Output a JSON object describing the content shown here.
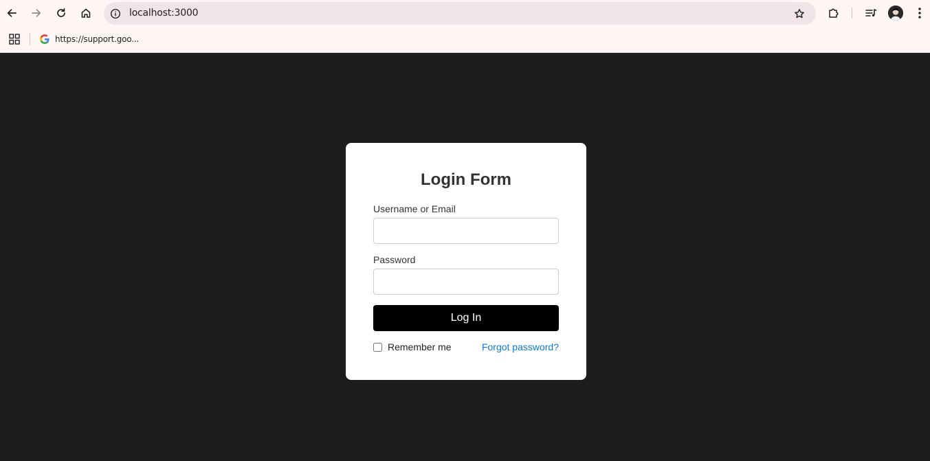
{
  "browser": {
    "url": "localhost:3000",
    "bookmark_label": "https://support.goo..."
  },
  "login": {
    "title": "Login Form",
    "username_label": "Username or Email",
    "username_value": "",
    "password_label": "Password",
    "password_value": "",
    "submit_label": "Log In",
    "remember_label": "Remember me",
    "remember_checked": false,
    "forgot_label": "Forgot password?"
  },
  "colors": {
    "page_background": "#1c1c1e",
    "card_background": "#ffffff",
    "button_background": "#000000",
    "link": "#0a7ad8"
  },
  "icons": {
    "back": "arrow-left-icon",
    "forward": "arrow-right-icon",
    "reload": "reload-icon",
    "home": "home-icon",
    "site_info": "info-icon",
    "bookmark_star": "star-icon",
    "extensions": "puzzle-icon",
    "media": "media-queue-icon",
    "menu": "kebab-menu-icon",
    "apps": "apps-grid-icon",
    "bookmark_favicon": "google-g-icon"
  }
}
